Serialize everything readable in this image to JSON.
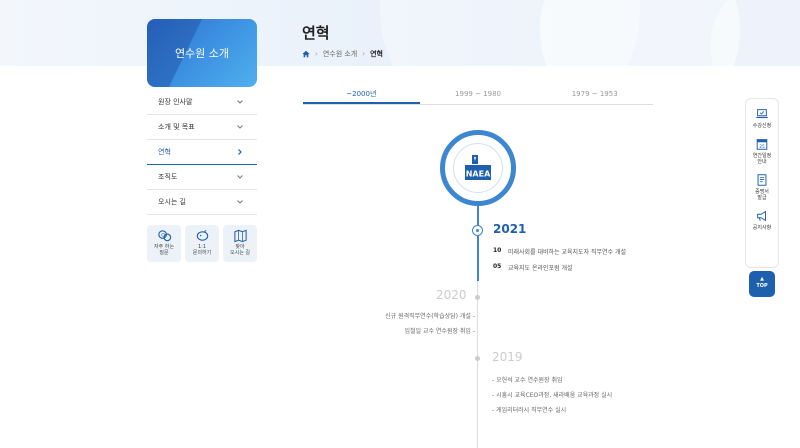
{
  "header": {
    "title": "연혁",
    "breadcrumb": [
      "연수원 소개",
      "연혁"
    ]
  },
  "sidebar": {
    "card_title": "연수원 소개",
    "items": [
      {
        "label": "원장 인사말"
      },
      {
        "label": "소개 및 목표"
      },
      {
        "label": "연혁"
      },
      {
        "label": "조직도"
      },
      {
        "label": "오시는 길"
      }
    ],
    "quick": [
      {
        "label1": "자주 하는",
        "label2": "질문"
      },
      {
        "label1": "1:1",
        "label2": "문의하기"
      },
      {
        "label1": "찾아",
        "label2": "오시는 길"
      }
    ]
  },
  "tabs": [
    "~2000년",
    "1999 ~ 1980",
    "1979 ~ 1953"
  ],
  "logo": {
    "text": "NAEA"
  },
  "timeline": {
    "y2021": {
      "year": "2021",
      "events": [
        {
          "month": "10",
          "text": "미래사회를 대비하는 교육지도자 직무연수 개설"
        },
        {
          "month": "05",
          "text": "교육지도 온라인포럼 개설"
        }
      ]
    },
    "y2020": {
      "year": "2020",
      "events": [
        "신규 원격직무연수(학습상담) 개설 -",
        "임철일 교수 연수원장 취임 -"
      ]
    },
    "y2019": {
      "year": "2019",
      "events": [
        "- 오헌석 교수 연수원장 취임",
        "- 시흥시 교육CEO과정, 새라배움 교육과정 실시",
        "- 게임리터러시 직무연수 실시"
      ]
    }
  },
  "rightbar": {
    "items": [
      {
        "l1": "수강신청",
        "l2": ""
      },
      {
        "l1": "연간일정",
        "l2": "안내"
      },
      {
        "l1": "증명서",
        "l2": "발급"
      },
      {
        "l1": "공지사항",
        "l2": ""
      }
    ],
    "calendar_day": "25",
    "top_label": "TOP"
  },
  "colors": {
    "accent": "#1e5fae",
    "ring": "#3c86d2"
  }
}
